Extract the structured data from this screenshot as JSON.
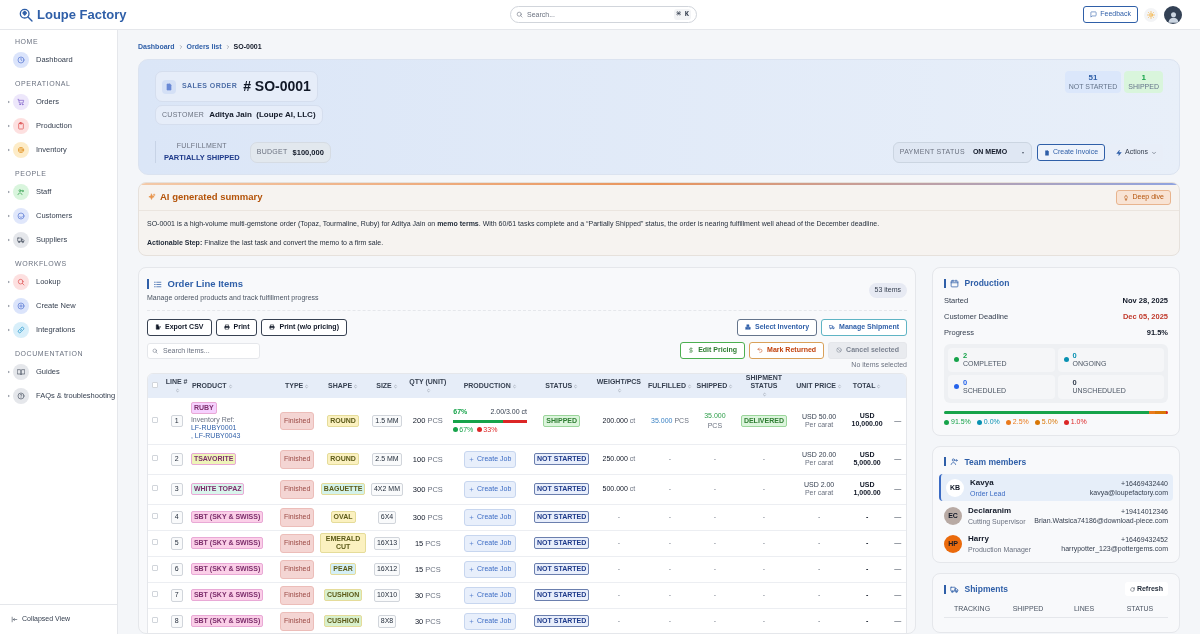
{
  "header": {
    "logo": "Loupe Factory",
    "search": {
      "placeholder": "Search...",
      "shortcut": "⌘ K"
    },
    "feedback": "Feedback"
  },
  "sidebar": {
    "sections": [
      {
        "title": "HOME",
        "items": [
          {
            "label": "Dashboard",
            "expandable": false
          }
        ]
      },
      {
        "title": "OPERATIONAL",
        "items": [
          {
            "label": "Orders",
            "expandable": true
          },
          {
            "label": "Production",
            "expandable": true
          },
          {
            "label": "Inventory",
            "expandable": true
          }
        ]
      },
      {
        "title": "PEOPLE",
        "items": [
          {
            "label": "Staff",
            "expandable": true
          },
          {
            "label": "Customers",
            "expandable": true
          },
          {
            "label": "Suppliers",
            "expandable": true
          }
        ]
      },
      {
        "title": "WORKFLOWS",
        "items": [
          {
            "label": "Lookup",
            "expandable": true
          },
          {
            "label": "Create New",
            "expandable": true
          },
          {
            "label": "Integrations",
            "expandable": true
          }
        ]
      },
      {
        "title": "DOCUMENTATION",
        "items": [
          {
            "label": "Guides",
            "expandable": true
          },
          {
            "label": "FAQs & troubleshooting",
            "expandable": true
          }
        ]
      }
    ],
    "collapse": "Collapsed View"
  },
  "breadcrumb": [
    "Dashboard",
    "Orders list",
    "SO-0001"
  ],
  "order": {
    "label": "SALES ORDER",
    "number": "# SO-0001",
    "customer_label": "CUSTOMER",
    "customer": "Aditya Jain  (Loupe AI, LLC)",
    "fulfillment_label": "FULFILLMENT",
    "fulfillment": "PARTIALLY SHIPPED",
    "budget_label": "BUDGET",
    "budget": "$100,000",
    "counters": [
      {
        "value": "51",
        "label": "NOT STARTED",
        "color": "#dbe7fb"
      },
      {
        "value": "1",
        "label": "SHIPPED",
        "color": "#d9f5dc"
      }
    ],
    "payment_status_label": "PAYMENT STATUS",
    "payment_status": "ON MEMO",
    "create_invoice": "Create Invoice",
    "actions": "Actions"
  },
  "summary": {
    "title": "AI generated summary",
    "deep_dive": "Deep dive",
    "paragraphs": [
      "SO-0001 is a high-volume multi-gemstone order (Topaz, Tourmaline, Ruby) for Aditya Jain on **memo terms**. With 60/61 tasks complete and a “Partially Shipped” status, the order is nearing fulfillment well ahead of the December deadline.",
      "**Actionable Step:** Finalize the last task and convert the memo to a firm sale."
    ]
  },
  "line_items": {
    "title": "Order Line Items",
    "subtitle": "Manage ordered products and track fulfillment progress",
    "count": "53 items",
    "left_buttons": [
      "Export CSV",
      "Print",
      "Print (w/o pricing)"
    ],
    "right_buttons": [
      "Select Inventory",
      "Manage Shipment"
    ],
    "actions": [
      {
        "label": "Edit Pricing",
        "kind": "pricing",
        "disabled": false
      },
      {
        "label": "Mark Returned",
        "kind": "returned",
        "disabled": false
      },
      {
        "label": "Cancel selected",
        "kind": "cancel",
        "disabled": true
      }
    ],
    "selection_note": "No items selected",
    "search_placeholder": "Search items...",
    "all_selected": false,
    "columns": [
      "LINE #",
      "PRODUCT",
      "TYPE",
      "SHAPE",
      "SIZE",
      "QTY (UNIT)",
      "PRODUCTION",
      "STATUS",
      "WEIGHT/PCS",
      "FULFILLED",
      "SHIPPED",
      "SHIPMENT STATUS",
      "UNIT PRICE",
      "TOTAL"
    ],
    "rows": [
      {
        "selected": false,
        "line": "1",
        "product": {
          "label": "RUBY",
          "color": "#f5d0fe"
        },
        "inventory_ref": {
          "label": "Inventory Ref:",
          "refs": [
            "LF-RUBY0001",
            ", LF-RUBY0043"
          ]
        },
        "type": "Finished",
        "shape": {
          "label": "ROUND",
          "color": "#fbf1c0"
        },
        "size": "1.5 MM",
        "qty": "200",
        "unit": "PCS",
        "production": {
          "kind": "progress",
          "percent": "67%",
          "amount": "2.00/3.00 ct",
          "segments": [
            {
              "level": 0.67,
              "label": "67%",
              "color": "#16a34a"
            },
            {
              "level": 0.33,
              "label": "33%",
              "color": "#dc2626"
            }
          ]
        },
        "status": {
          "label": "SHIPPED",
          "kind": "shipped"
        },
        "weight": {
          "value": "200.000",
          "unit": "ct"
        },
        "fulfilled": {
          "value": "35.000",
          "unit": "PCS"
        },
        "shipped": {
          "value": "35.000",
          "unit": "PCS"
        },
        "shipment_status": {
          "label": "DELIVERED",
          "kind": "badge"
        },
        "unit_price": {
          "value": "USD 50.00",
          "note": "Per carat"
        },
        "total": "USD 10,000.00",
        "action": "—"
      },
      {
        "selected": false,
        "line": "2",
        "product": {
          "label": "TSAVORITE",
          "color": "#eef4b8"
        },
        "type": "Finished",
        "shape": {
          "label": "ROUND",
          "color": "#fbf1c0"
        },
        "size": "2.5 MM",
        "qty": "100",
        "unit": "PCS",
        "production": {
          "kind": "create_job",
          "label": "Create Job"
        },
        "status": {
          "label": "NOT STARTED",
          "kind": "not_started"
        },
        "weight": {
          "value": "250.000",
          "unit": "ct"
        },
        "fulfilled": {
          "value": "-"
        },
        "shipped": {
          "value": "-"
        },
        "shipment_status": {
          "label": "-",
          "kind": "empty"
        },
        "unit_price": {
          "value": "USD 20.00",
          "note": "Per carat"
        },
        "total": "USD 5,000.00",
        "action": "—"
      },
      {
        "selected": false,
        "line": "3",
        "product": {
          "label": "WHITE TOPAZ",
          "color": "#d9f5ec"
        },
        "type": "Finished",
        "shape": {
          "label": "BAGUETTE",
          "color": "#d3f2ea"
        },
        "size": "4X2 MM",
        "qty": "300",
        "unit": "PCS",
        "production": {
          "kind": "create_job",
          "label": "Create Job"
        },
        "status": {
          "label": "NOT STARTED",
          "kind": "not_started"
        },
        "weight": {
          "value": "500.000",
          "unit": "ct"
        },
        "fulfilled": {
          "value": "-"
        },
        "shipped": {
          "value": "-"
        },
        "shipment_status": {
          "label": "-",
          "kind": "empty"
        },
        "unit_price": {
          "value": "USD 2.00",
          "note": "Per carat"
        },
        "total": "USD 1,000.00",
        "action": "—"
      },
      {
        "selected": false,
        "line": "4",
        "product": {
          "label": "SBT (SKY & SWISS)",
          "color": "#fbcfe8"
        },
        "type": "Finished",
        "shape": {
          "label": "OVAL",
          "color": "#fbf1c0"
        },
        "size": "6X4",
        "qty": "300",
        "unit": "PCS",
        "production": {
          "kind": "create_job",
          "label": "Create Job"
        },
        "status": {
          "label": "NOT STARTED",
          "kind": "not_started"
        },
        "weight": {
          "value": "-"
        },
        "fulfilled": {
          "value": "-"
        },
        "shipped": {
          "value": "-"
        },
        "shipment_status": {
          "label": "-",
          "kind": "empty"
        },
        "unit_price": {
          "value": "-"
        },
        "total": "-",
        "action": "—"
      },
      {
        "selected": false,
        "line": "5",
        "product": {
          "label": "SBT (SKY & SWISS)",
          "color": "#fbcfe8"
        },
        "type": "Finished",
        "shape": {
          "label": "EMERALD CUT",
          "color": "#fbf1c0"
        },
        "size": "16X13",
        "qty": "15",
        "unit": "PCS",
        "production": {
          "kind": "create_job",
          "label": "Create Job"
        },
        "status": {
          "label": "NOT STARTED",
          "kind": "not_started"
        },
        "weight": {
          "value": "-"
        },
        "fulfilled": {
          "value": "-"
        },
        "shipped": {
          "value": "-"
        },
        "shipment_status": {
          "label": "-",
          "kind": "empty"
        },
        "unit_price": {
          "value": "-"
        },
        "total": "-",
        "action": "—"
      },
      {
        "selected": false,
        "line": "6",
        "product": {
          "label": "SBT (SKY & SWISS)",
          "color": "#fbcfe8"
        },
        "type": "Finished",
        "shape": {
          "label": "PEAR",
          "color": "#d4eff6"
        },
        "size": "16X12",
        "qty": "15",
        "unit": "PCS",
        "production": {
          "kind": "create_job",
          "label": "Create Job"
        },
        "status": {
          "label": "NOT STARTED",
          "kind": "not_started"
        },
        "weight": {
          "value": "-"
        },
        "fulfilled": {
          "value": "-"
        },
        "shipped": {
          "value": "-"
        },
        "shipment_status": {
          "label": "-",
          "kind": "empty"
        },
        "unit_price": {
          "value": "-"
        },
        "total": "-",
        "action": "—"
      },
      {
        "selected": false,
        "line": "7",
        "product": {
          "label": "SBT (SKY & SWISS)",
          "color": "#fbcfe8"
        },
        "type": "Finished",
        "shape": {
          "label": "CUSHION",
          "color": "#d8f0cc"
        },
        "size": "10X10",
        "qty": "30",
        "unit": "PCS",
        "production": {
          "kind": "create_job",
          "label": "Create Job"
        },
        "status": {
          "label": "NOT STARTED",
          "kind": "not_started"
        },
        "weight": {
          "value": "-"
        },
        "fulfilled": {
          "value": "-"
        },
        "shipped": {
          "value": "-"
        },
        "shipment_status": {
          "label": "-",
          "kind": "empty"
        },
        "unit_price": {
          "value": "-"
        },
        "total": "-",
        "action": "—"
      },
      {
        "selected": false,
        "line": "8",
        "product": {
          "label": "SBT (SKY & SWISS)",
          "color": "#fbcfe8"
        },
        "type": "Finished",
        "shape": {
          "label": "CUSHION",
          "color": "#d8f0cc"
        },
        "size": "8X8",
        "qty": "30",
        "unit": "PCS",
        "production": {
          "kind": "create_job",
          "label": "Create Job"
        },
        "status": {
          "label": "NOT STARTED",
          "kind": "not_started"
        },
        "weight": {
          "value": "-"
        },
        "fulfilled": {
          "value": "-"
        },
        "shipped": {
          "value": "-"
        },
        "shipment_status": {
          "label": "-",
          "kind": "empty"
        },
        "unit_price": {
          "value": "-"
        },
        "total": "-",
        "action": "—"
      }
    ]
  },
  "production": {
    "title": "Production",
    "facts": [
      {
        "label": "Started",
        "value": "Nov 28, 2025",
        "alert": false
      },
      {
        "label": "Customer Deadline",
        "value": "Dec 05, 2025",
        "alert": true
      },
      {
        "label": "Progress",
        "value": "91.5%",
        "alert": false
      }
    ],
    "stats": [
      {
        "value": "2",
        "label": "COMPLETED",
        "color": "#16a34a"
      },
      {
        "value": "0",
        "label": "ONGOING",
        "color": "#0891b2"
      },
      {
        "value": "0",
        "label": "SCHEDULED",
        "color": "#2563eb"
      },
      {
        "value": "0",
        "label": "UNSCHEDULED"
      }
    ],
    "segments": [
      {
        "level": 0.915,
        "label": "91.5%",
        "color": "#16a34a"
      },
      {
        "label": "0.0%",
        "color": "#0891b2"
      },
      {
        "level": 0.025,
        "label": "2.5%",
        "color": "#ea7a1c"
      },
      {
        "level": 0.05,
        "label": "5.0%",
        "color": "#d97706"
      },
      {
        "level": 0.01,
        "label": "1.0%",
        "color": "#dc2626"
      }
    ]
  },
  "team": {
    "title": "Team members",
    "members": [
      {
        "initials": "KB",
        "name": "Kavya",
        "role": "Order Lead",
        "phone": "+16469432440",
        "email": "kavya@loupefactory.com",
        "selected": true,
        "color": "#ffffff"
      },
      {
        "initials": "EC",
        "name": "Declaranim",
        "role": "Cutting Supervisor",
        "phone": "+19414012346",
        "email": "Brian.Watsica74186@download-piece.com",
        "selected": false,
        "color": "#b8aaa4"
      },
      {
        "initials": "HP",
        "name": "Harry",
        "role": "Production Manager",
        "phone": "+16469432452",
        "email": "harrypotter_123@pottergems.com",
        "selected": false,
        "color": "#ea6a0c"
      }
    ]
  },
  "shipments": {
    "title": "Shipments",
    "refresh": "Refresh",
    "columns": [
      "TRACKING",
      "SHIPPED",
      "LINES",
      "STATUS"
    ]
  }
}
